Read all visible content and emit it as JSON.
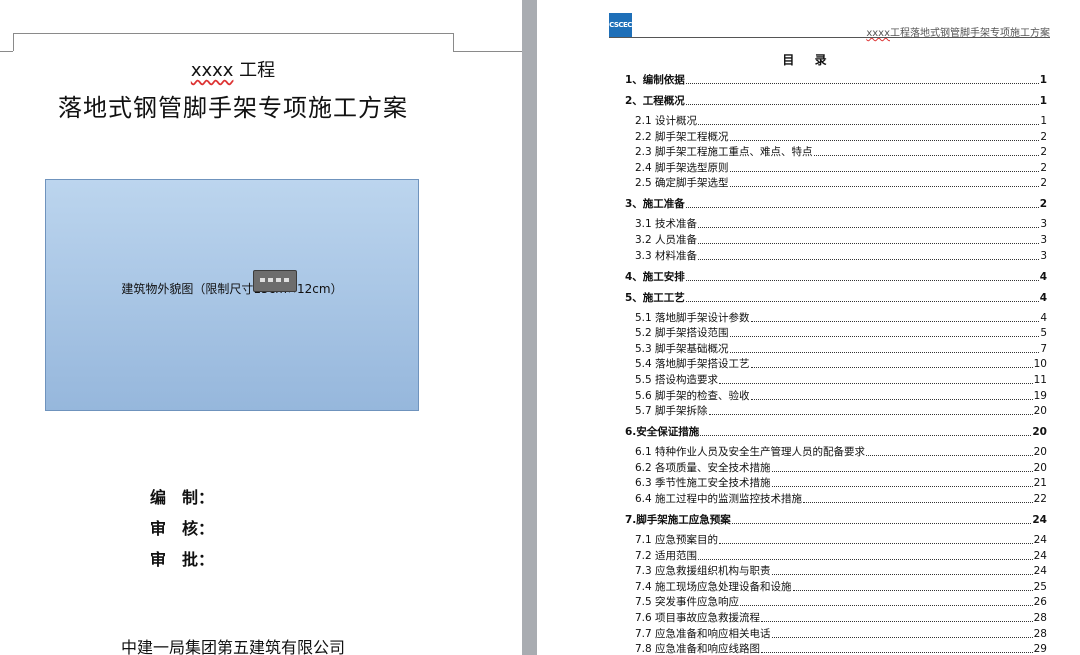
{
  "cover": {
    "title_prefix": "xxxx",
    "title_suffix": " 工程",
    "main_title": "落地式钢管脚手架专项施工方案",
    "image_caption": "建筑物外貌图（限制尺寸15cm×12cm）",
    "sign_lines": [
      "编　制：",
      "审　核：",
      "审　批："
    ],
    "company": "中建一局集团第五建筑有限公司"
  },
  "header": {
    "logo_text": "CSCEC",
    "prefix": "xxxx",
    "text": "工程落地式钢管脚手架专项施工方案"
  },
  "toc": {
    "title": "目 录",
    "entries": [
      {
        "level": 1,
        "label": "1、编制依据",
        "page": "1"
      },
      {
        "level": 1,
        "label": "2、工程概况",
        "page": "1"
      },
      {
        "level": 2,
        "label": "2.1 设计概况",
        "page": "1"
      },
      {
        "level": 2,
        "label": "2.2 脚手架工程概况",
        "page": "2"
      },
      {
        "level": 2,
        "label": "2.3 脚手架工程施工重点、难点、特点",
        "page": "2"
      },
      {
        "level": 2,
        "label": "2.4 脚手架选型原则",
        "page": "2"
      },
      {
        "level": 2,
        "label": "2.5 确定脚手架选型",
        "page": "2"
      },
      {
        "level": 1,
        "label": "3、施工准备",
        "page": "2"
      },
      {
        "level": 2,
        "label": "3.1 技术准备",
        "page": "3"
      },
      {
        "level": 2,
        "label": "3.2 人员准备",
        "page": "3"
      },
      {
        "level": 2,
        "label": "3.3 材料准备",
        "page": "3"
      },
      {
        "level": 1,
        "label": "4、施工安排",
        "page": "4"
      },
      {
        "level": 1,
        "label": "5、施工工艺",
        "page": "4"
      },
      {
        "level": 2,
        "label": "5.1 落地脚手架设计参数",
        "page": "4"
      },
      {
        "level": 2,
        "label": "5.2 脚手架搭设范围",
        "page": "5"
      },
      {
        "level": 2,
        "label": "5.3 脚手架基础概况",
        "page": "7"
      },
      {
        "level": 2,
        "label": "5.4 落地脚手架搭设工艺",
        "page": "10"
      },
      {
        "level": 2,
        "label": "5.5 搭设构造要求",
        "page": "11"
      },
      {
        "level": 2,
        "label": "5.6 脚手架的检查、验收",
        "page": "19"
      },
      {
        "level": 2,
        "label": "5.7 脚手架拆除",
        "page": "20"
      },
      {
        "level": 1,
        "label": "6.安全保证措施",
        "page": "20"
      },
      {
        "level": 2,
        "label": "6.1 特种作业人员及安全生产管理人员的配备要求",
        "page": "20"
      },
      {
        "level": 2,
        "label": "6.2 各项质量、安全技术措施",
        "page": "20"
      },
      {
        "level": 2,
        "label": "6.3 季节性施工安全技术措施",
        "page": "21"
      },
      {
        "level": 2,
        "label": "6.4 施工过程中的监测监控技术措施",
        "page": "22"
      },
      {
        "level": 1,
        "label": "7.脚手架施工应急预案",
        "page": "24"
      },
      {
        "level": 2,
        "label": "7.1 应急预案目的",
        "page": "24"
      },
      {
        "level": 2,
        "label": "7.2 适用范围",
        "page": "24"
      },
      {
        "level": 2,
        "label": "7.3 应急救援组织机构与职责",
        "page": "24"
      },
      {
        "level": 2,
        "label": "7.4 施工现场应急处理设备和设施",
        "page": "25"
      },
      {
        "level": 2,
        "label": "7.5 突发事件应急响应",
        "page": "26"
      },
      {
        "level": 2,
        "label": "7.6 项目事故应急救援流程",
        "page": "28"
      },
      {
        "level": 2,
        "label": "7.7 应急准备和响应相关电话",
        "page": "28"
      },
      {
        "level": 2,
        "label": "7.8 应急准备和响应线路图",
        "page": "29"
      }
    ]
  }
}
